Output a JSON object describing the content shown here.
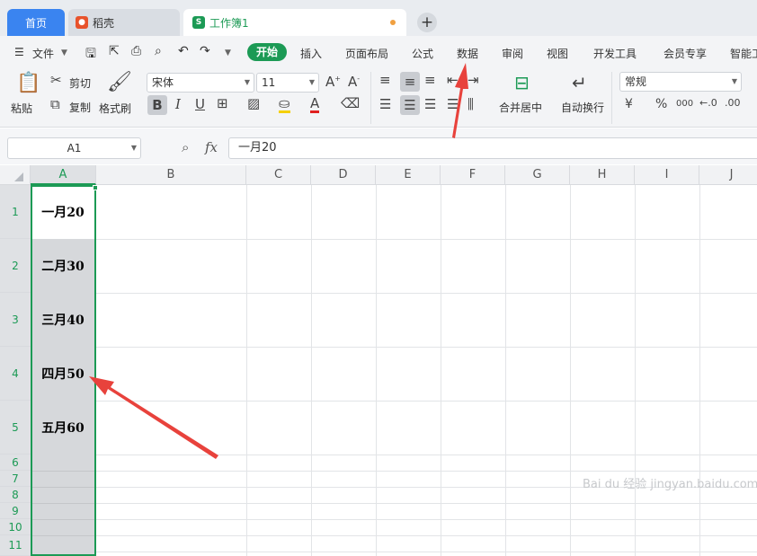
{
  "tabs": {
    "home": "首页",
    "daoke": "稻壳",
    "workbook": "工作簿1",
    "new_tab": "+"
  },
  "menu": {
    "file": "文件",
    "start": "开始",
    "items": [
      "插入",
      "页面布局",
      "公式",
      "数据",
      "审阅",
      "视图",
      "开发工具",
      "会员专享",
      "智能工"
    ]
  },
  "toolbar": {
    "paste": "粘贴",
    "cut": "剪切",
    "copy": "复制",
    "format_painter": "格式刷",
    "font_name": "宋体",
    "font_size": "11",
    "merge_center": "合并居中",
    "wrap_text": "自动换行",
    "number_format": "常规",
    "currency": "¥",
    "percent": "%",
    "thousands": "000"
  },
  "formula_bar": {
    "name_box": "A1",
    "fx": "fx",
    "content": "一月20"
  },
  "columns": [
    "A",
    "B",
    "C",
    "D",
    "E",
    "F",
    "G",
    "H",
    "I",
    "J"
  ],
  "rows": [
    "1",
    "2",
    "3",
    "4",
    "5",
    "6",
    "7",
    "8",
    "9",
    "10",
    "11"
  ],
  "cells_A": [
    "一月20",
    "二月30",
    "三月40",
    "四月50",
    "五月60"
  ],
  "watermark": "Bai du 经验 jingyan.baidu.com",
  "colors": {
    "accent_green": "#1c9a55",
    "tab_blue": "#3a84f0",
    "annotation_red": "#e8423c"
  }
}
